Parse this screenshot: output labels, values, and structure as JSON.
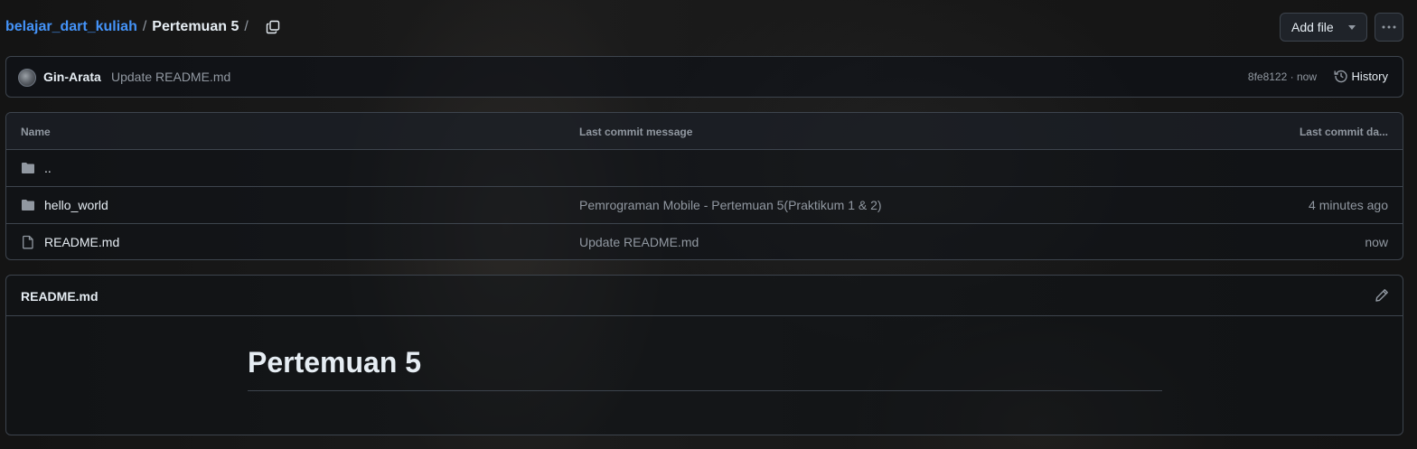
{
  "breadcrumb": {
    "repo": "belajar_dart_kuliah",
    "separator": "/",
    "current": "Pertemuan 5",
    "trailing_separator": "/"
  },
  "actions": {
    "add_file_label": "Add file",
    "more_icon": "kebab-horizontal-icon"
  },
  "latest_commit": {
    "author": "Gin-Arata",
    "message": "Update README.md",
    "sha": "8fe8122",
    "dot": "·",
    "time": "now",
    "history_label": "History"
  },
  "file_table": {
    "headers": {
      "name": "Name",
      "message": "Last commit message",
      "date": "Last commit da..."
    },
    "rows": [
      {
        "type": "folder",
        "name": "..",
        "message": "",
        "date": ""
      },
      {
        "type": "folder",
        "name": "hello_world",
        "message": "Pemrograman Mobile - Pertemuan 5(Praktikum 1 & 2)",
        "date": "4 minutes ago"
      },
      {
        "type": "file",
        "name": "README.md",
        "message": "Update README.md",
        "date": "now"
      }
    ]
  },
  "readme": {
    "filename": "README.md",
    "heading": "Pertemuan 5"
  },
  "colors": {
    "link": "#4493f8",
    "border": "#3d444d",
    "muted": "#9198a1",
    "text": "#e6edf3"
  }
}
